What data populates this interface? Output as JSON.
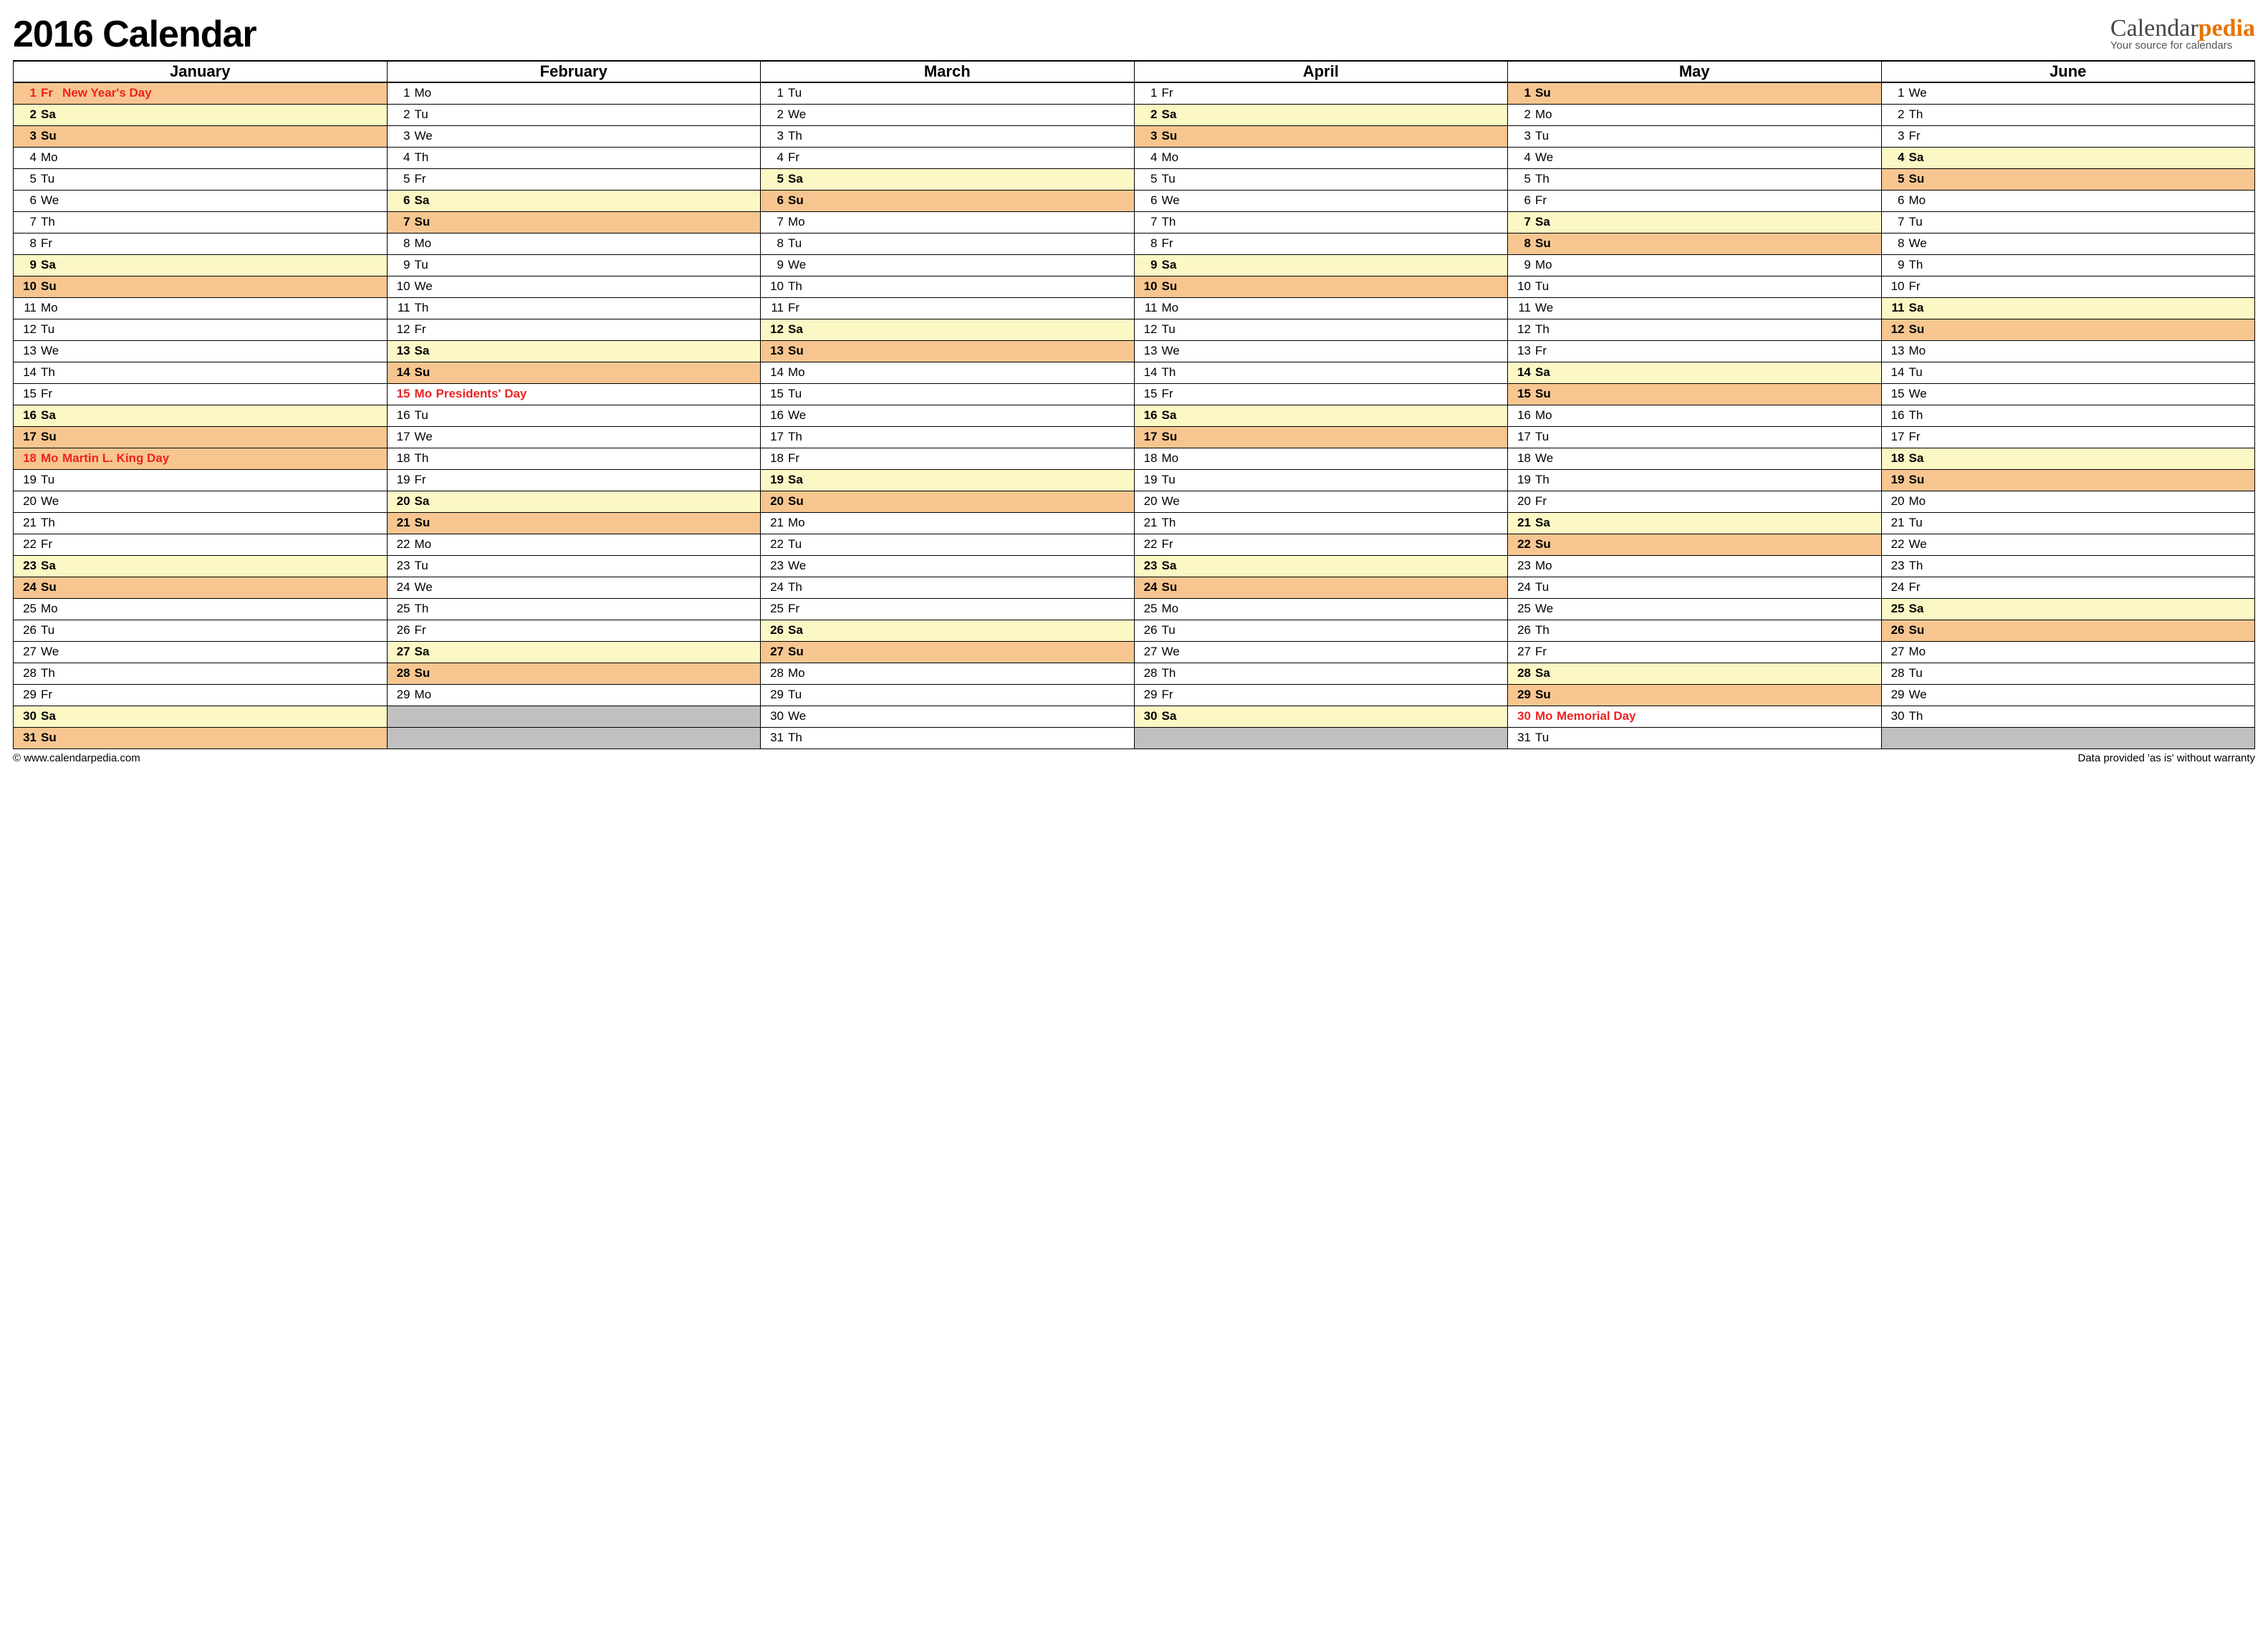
{
  "title": "2016 Calendar",
  "logo": {
    "prefix": "Calendar",
    "suffix": "pedia",
    "tagline": "Your source for calendars"
  },
  "footer": {
    "left": "© www.calendarpedia.com",
    "right": "Data provided 'as is' without warranty"
  },
  "months": [
    "January",
    "February",
    "March",
    "April",
    "May",
    "June"
  ],
  "days": [
    [
      {
        "n": 1,
        "d": "Fr",
        "h": "New Year's Day",
        "holiday": true,
        "c": "sun"
      },
      {
        "n": 2,
        "d": "Sa",
        "c": "sat"
      },
      {
        "n": 3,
        "d": "Su",
        "c": "sun"
      },
      {
        "n": 4,
        "d": "Mo"
      },
      {
        "n": 5,
        "d": "Tu"
      },
      {
        "n": 6,
        "d": "We"
      },
      {
        "n": 7,
        "d": "Th"
      },
      {
        "n": 8,
        "d": "Fr"
      },
      {
        "n": 9,
        "d": "Sa",
        "c": "sat"
      },
      {
        "n": 10,
        "d": "Su",
        "c": "sun"
      },
      {
        "n": 11,
        "d": "Mo"
      },
      {
        "n": 12,
        "d": "Tu"
      },
      {
        "n": 13,
        "d": "We"
      },
      {
        "n": 14,
        "d": "Th"
      },
      {
        "n": 15,
        "d": "Fr"
      },
      {
        "n": 16,
        "d": "Sa",
        "c": "sat"
      },
      {
        "n": 17,
        "d": "Su",
        "c": "sun"
      },
      {
        "n": 18,
        "d": "Mo",
        "h": "Martin L. King Day",
        "holiday": true,
        "c": "sun"
      },
      {
        "n": 19,
        "d": "Tu"
      },
      {
        "n": 20,
        "d": "We"
      },
      {
        "n": 21,
        "d": "Th"
      },
      {
        "n": 22,
        "d": "Fr"
      },
      {
        "n": 23,
        "d": "Sa",
        "c": "sat"
      },
      {
        "n": 24,
        "d": "Su",
        "c": "sun"
      },
      {
        "n": 25,
        "d": "Mo"
      },
      {
        "n": 26,
        "d": "Tu"
      },
      {
        "n": 27,
        "d": "We"
      },
      {
        "n": 28,
        "d": "Th"
      },
      {
        "n": 29,
        "d": "Fr"
      },
      {
        "n": 30,
        "d": "Sa",
        "c": "sat"
      },
      {
        "n": 31,
        "d": "Su",
        "c": "sun"
      }
    ],
    [
      {
        "n": 1,
        "d": "Mo"
      },
      {
        "n": 2,
        "d": "Tu"
      },
      {
        "n": 3,
        "d": "We"
      },
      {
        "n": 4,
        "d": "Th"
      },
      {
        "n": 5,
        "d": "Fr"
      },
      {
        "n": 6,
        "d": "Sa",
        "c": "sat"
      },
      {
        "n": 7,
        "d": "Su",
        "c": "sun"
      },
      {
        "n": 8,
        "d": "Mo"
      },
      {
        "n": 9,
        "d": "Tu"
      },
      {
        "n": 10,
        "d": "We"
      },
      {
        "n": 11,
        "d": "Th"
      },
      {
        "n": 12,
        "d": "Fr"
      },
      {
        "n": 13,
        "d": "Sa",
        "c": "sat"
      },
      {
        "n": 14,
        "d": "Su",
        "c": "sun"
      },
      {
        "n": 15,
        "d": "Mo",
        "h": "Presidents' Day",
        "holiday": true
      },
      {
        "n": 16,
        "d": "Tu"
      },
      {
        "n": 17,
        "d": "We"
      },
      {
        "n": 18,
        "d": "Th"
      },
      {
        "n": 19,
        "d": "Fr"
      },
      {
        "n": 20,
        "d": "Sa",
        "c": "sat"
      },
      {
        "n": 21,
        "d": "Su",
        "c": "sun"
      },
      {
        "n": 22,
        "d": "Mo"
      },
      {
        "n": 23,
        "d": "Tu"
      },
      {
        "n": 24,
        "d": "We"
      },
      {
        "n": 25,
        "d": "Th"
      },
      {
        "n": 26,
        "d": "Fr"
      },
      {
        "n": 27,
        "d": "Sa",
        "c": "sat"
      },
      {
        "n": 28,
        "d": "Su",
        "c": "sun"
      },
      {
        "n": 29,
        "d": "Mo"
      },
      {
        "blank": true
      },
      {
        "blank": true
      }
    ],
    [
      {
        "n": 1,
        "d": "Tu"
      },
      {
        "n": 2,
        "d": "We"
      },
      {
        "n": 3,
        "d": "Th"
      },
      {
        "n": 4,
        "d": "Fr"
      },
      {
        "n": 5,
        "d": "Sa",
        "c": "sat"
      },
      {
        "n": 6,
        "d": "Su",
        "c": "sun"
      },
      {
        "n": 7,
        "d": "Mo"
      },
      {
        "n": 8,
        "d": "Tu"
      },
      {
        "n": 9,
        "d": "We"
      },
      {
        "n": 10,
        "d": "Th"
      },
      {
        "n": 11,
        "d": "Fr"
      },
      {
        "n": 12,
        "d": "Sa",
        "c": "sat"
      },
      {
        "n": 13,
        "d": "Su",
        "c": "sun"
      },
      {
        "n": 14,
        "d": "Mo"
      },
      {
        "n": 15,
        "d": "Tu"
      },
      {
        "n": 16,
        "d": "We"
      },
      {
        "n": 17,
        "d": "Th"
      },
      {
        "n": 18,
        "d": "Fr"
      },
      {
        "n": 19,
        "d": "Sa",
        "c": "sat"
      },
      {
        "n": 20,
        "d": "Su",
        "c": "sun"
      },
      {
        "n": 21,
        "d": "Mo"
      },
      {
        "n": 22,
        "d": "Tu"
      },
      {
        "n": 23,
        "d": "We"
      },
      {
        "n": 24,
        "d": "Th"
      },
      {
        "n": 25,
        "d": "Fr"
      },
      {
        "n": 26,
        "d": "Sa",
        "c": "sat"
      },
      {
        "n": 27,
        "d": "Su",
        "c": "sun"
      },
      {
        "n": 28,
        "d": "Mo"
      },
      {
        "n": 29,
        "d": "Tu"
      },
      {
        "n": 30,
        "d": "We"
      },
      {
        "n": 31,
        "d": "Th"
      }
    ],
    [
      {
        "n": 1,
        "d": "Fr"
      },
      {
        "n": 2,
        "d": "Sa",
        "c": "sat"
      },
      {
        "n": 3,
        "d": "Su",
        "c": "sun"
      },
      {
        "n": 4,
        "d": "Mo"
      },
      {
        "n": 5,
        "d": "Tu"
      },
      {
        "n": 6,
        "d": "We"
      },
      {
        "n": 7,
        "d": "Th"
      },
      {
        "n": 8,
        "d": "Fr"
      },
      {
        "n": 9,
        "d": "Sa",
        "c": "sat"
      },
      {
        "n": 10,
        "d": "Su",
        "c": "sun"
      },
      {
        "n": 11,
        "d": "Mo"
      },
      {
        "n": 12,
        "d": "Tu"
      },
      {
        "n": 13,
        "d": "We"
      },
      {
        "n": 14,
        "d": "Th"
      },
      {
        "n": 15,
        "d": "Fr"
      },
      {
        "n": 16,
        "d": "Sa",
        "c": "sat"
      },
      {
        "n": 17,
        "d": "Su",
        "c": "sun"
      },
      {
        "n": 18,
        "d": "Mo"
      },
      {
        "n": 19,
        "d": "Tu"
      },
      {
        "n": 20,
        "d": "We"
      },
      {
        "n": 21,
        "d": "Th"
      },
      {
        "n": 22,
        "d": "Fr"
      },
      {
        "n": 23,
        "d": "Sa",
        "c": "sat"
      },
      {
        "n": 24,
        "d": "Su",
        "c": "sun"
      },
      {
        "n": 25,
        "d": "Mo"
      },
      {
        "n": 26,
        "d": "Tu"
      },
      {
        "n": 27,
        "d": "We"
      },
      {
        "n": 28,
        "d": "Th"
      },
      {
        "n": 29,
        "d": "Fr"
      },
      {
        "n": 30,
        "d": "Sa",
        "c": "sat"
      },
      {
        "blank": true
      }
    ],
    [
      {
        "n": 1,
        "d": "Su",
        "c": "sun"
      },
      {
        "n": 2,
        "d": "Mo"
      },
      {
        "n": 3,
        "d": "Tu"
      },
      {
        "n": 4,
        "d": "We"
      },
      {
        "n": 5,
        "d": "Th"
      },
      {
        "n": 6,
        "d": "Fr"
      },
      {
        "n": 7,
        "d": "Sa",
        "c": "sat"
      },
      {
        "n": 8,
        "d": "Su",
        "c": "sun"
      },
      {
        "n": 9,
        "d": "Mo"
      },
      {
        "n": 10,
        "d": "Tu"
      },
      {
        "n": 11,
        "d": "We"
      },
      {
        "n": 12,
        "d": "Th"
      },
      {
        "n": 13,
        "d": "Fr"
      },
      {
        "n": 14,
        "d": "Sa",
        "c": "sat"
      },
      {
        "n": 15,
        "d": "Su",
        "c": "sun"
      },
      {
        "n": 16,
        "d": "Mo"
      },
      {
        "n": 17,
        "d": "Tu"
      },
      {
        "n": 18,
        "d": "We"
      },
      {
        "n": 19,
        "d": "Th"
      },
      {
        "n": 20,
        "d": "Fr"
      },
      {
        "n": 21,
        "d": "Sa",
        "c": "sat"
      },
      {
        "n": 22,
        "d": "Su",
        "c": "sun"
      },
      {
        "n": 23,
        "d": "Mo"
      },
      {
        "n": 24,
        "d": "Tu"
      },
      {
        "n": 25,
        "d": "We"
      },
      {
        "n": 26,
        "d": "Th"
      },
      {
        "n": 27,
        "d": "Fr"
      },
      {
        "n": 28,
        "d": "Sa",
        "c": "sat"
      },
      {
        "n": 29,
        "d": "Su",
        "c": "sun"
      },
      {
        "n": 30,
        "d": "Mo",
        "h": "Memorial Day",
        "holiday": true
      },
      {
        "n": 31,
        "d": "Tu"
      }
    ],
    [
      {
        "n": 1,
        "d": "We"
      },
      {
        "n": 2,
        "d": "Th"
      },
      {
        "n": 3,
        "d": "Fr"
      },
      {
        "n": 4,
        "d": "Sa",
        "c": "sat"
      },
      {
        "n": 5,
        "d": "Su",
        "c": "sun"
      },
      {
        "n": 6,
        "d": "Mo"
      },
      {
        "n": 7,
        "d": "Tu"
      },
      {
        "n": 8,
        "d": "We"
      },
      {
        "n": 9,
        "d": "Th"
      },
      {
        "n": 10,
        "d": "Fr"
      },
      {
        "n": 11,
        "d": "Sa",
        "c": "sat"
      },
      {
        "n": 12,
        "d": "Su",
        "c": "sun"
      },
      {
        "n": 13,
        "d": "Mo"
      },
      {
        "n": 14,
        "d": "Tu"
      },
      {
        "n": 15,
        "d": "We"
      },
      {
        "n": 16,
        "d": "Th"
      },
      {
        "n": 17,
        "d": "Fr"
      },
      {
        "n": 18,
        "d": "Sa",
        "c": "sat"
      },
      {
        "n": 19,
        "d": "Su",
        "c": "sun"
      },
      {
        "n": 20,
        "d": "Mo"
      },
      {
        "n": 21,
        "d": "Tu"
      },
      {
        "n": 22,
        "d": "We"
      },
      {
        "n": 23,
        "d": "Th"
      },
      {
        "n": 24,
        "d": "Fr"
      },
      {
        "n": 25,
        "d": "Sa",
        "c": "sat"
      },
      {
        "n": 26,
        "d": "Su",
        "c": "sun"
      },
      {
        "n": 27,
        "d": "Mo"
      },
      {
        "n": 28,
        "d": "Tu"
      },
      {
        "n": 29,
        "d": "We"
      },
      {
        "n": 30,
        "d": "Th"
      },
      {
        "blank": true
      }
    ]
  ]
}
